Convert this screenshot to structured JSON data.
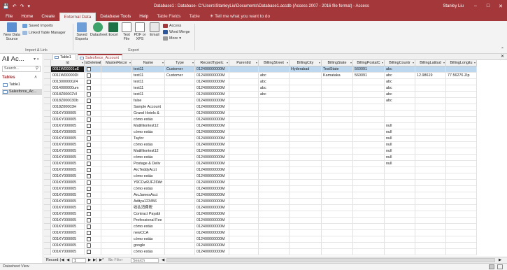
{
  "window": {
    "title": "Database1 : Database- C:\\Users\\StanleyLiu\\Documents\\Database1.accdb (Access 2007 - 2016 file format) - Access",
    "user": "Stanley Liu",
    "qat_icons": [
      "save-icon",
      "undo-icon",
      "redo-icon",
      "customize-icon"
    ]
  },
  "ribbon": {
    "tabs": [
      "File",
      "Home",
      "Create",
      "External Data",
      "Database Tools",
      "Help",
      "Table Fields",
      "Table"
    ],
    "active_tab": "External Data",
    "tell_me": "Tell me what you want to do",
    "import_group": {
      "label": "Import & Link",
      "new_data_source": "New Data Source",
      "saved_imports": "Saved Imports",
      "linked_table_manager": "Linked Table Manager"
    },
    "export_group": {
      "label": "Export",
      "saved_exports": "Saved Exports",
      "datasheet": "Datasheet",
      "excel": "Excel",
      "text_file": "Text File",
      "pdf_xps": "PDF or XPS",
      "email": "Email",
      "access": "Access",
      "word_merge": "Word Merge",
      "more": "More"
    }
  },
  "nav_pane": {
    "title": "All Ac...",
    "search_placeholder": "Search...",
    "section": "Tables",
    "items": [
      "Table1",
      "Salesforce_Ac..."
    ]
  },
  "doc_tabs": [
    "Table1",
    "Salesforce_Account"
  ],
  "grid": {
    "columns": [
      "Id",
      "IsDeleted",
      "MasterRecor",
      "Name",
      "Type",
      "RecordTypeIc",
      "ParentId",
      "BillingStreet",
      "BillingCity",
      "BillingState",
      "BillingPostalC",
      "BillingCountr",
      "BillingLatitud",
      "BillingLongitu"
    ],
    "rows": [
      [
        "0011W00001uE",
        "",
        "",
        "test11",
        "Customer",
        "012400000000M",
        "",
        "",
        "Hyderabad",
        "TestState",
        "560091",
        "abc",
        "",
        ""
      ],
      [
        "0011W00000Dl",
        "",
        "",
        "test11",
        "Customer",
        "012400000000M",
        "",
        "abc",
        "",
        "Karnataka",
        "560091",
        "abc",
        "12.98619",
        "77.56276 Zip"
      ],
      [
        "0013000000Z4",
        "",
        "",
        "test11",
        "",
        "012400000000M",
        "",
        "abc",
        "",
        "",
        "",
        "abc",
        "",
        ""
      ],
      [
        "0014000000um",
        "",
        "",
        "test11",
        "",
        "012400000000M",
        "",
        "abc",
        "",
        "",
        "",
        "abc",
        "",
        ""
      ],
      [
        "0018Z00002Vl",
        "",
        "",
        "test11",
        "",
        "012400000000M",
        "",
        "abc",
        "",
        "",
        "",
        "abc",
        "",
        ""
      ],
      [
        "0018Z00003Db",
        "",
        "",
        "false",
        "",
        "012400000000M",
        "",
        "",
        "",
        "",
        "",
        "abc",
        "",
        ""
      ],
      [
        "0018Z00003H",
        "",
        "",
        "Sample Account",
        "",
        "012400000000M",
        "",
        "",
        "",
        "",
        "",
        "",
        "",
        ""
      ],
      [
        "001KY000005",
        "",
        "",
        "Grand Hotels &",
        "",
        "012400000000M",
        "",
        "",
        "",
        "",
        "",
        "",
        "",
        ""
      ],
      [
        "001KY000005",
        "",
        "",
        "cómo estás",
        "",
        "012400000000M",
        "",
        "",
        "",
        "",
        "",
        "",
        "",
        ""
      ],
      [
        "001KY000005",
        "",
        "",
        "Matillliontest12",
        "",
        "012400000000M",
        "",
        "",
        "",
        "",
        "",
        "null",
        "",
        ""
      ],
      [
        "001KY000005",
        "",
        "",
        "cómo estás",
        "",
        "012400000000M",
        "",
        "",
        "",
        "",
        "",
        "null",
        "",
        ""
      ],
      [
        "001KY000005",
        "",
        "",
        "Taylor",
        "",
        "012400000000M",
        "",
        "",
        "",
        "",
        "",
        "null",
        "",
        ""
      ],
      [
        "001KY000005",
        "",
        "",
        "cómo estás",
        "",
        "012400000000M",
        "",
        "",
        "",
        "",
        "",
        "null",
        "",
        ""
      ],
      [
        "001KY000005",
        "",
        "",
        "Matillliontest12",
        "",
        "012400000000M",
        "",
        "",
        "",
        "",
        "",
        "null",
        "",
        ""
      ],
      [
        "001KY000005",
        "",
        "",
        "cómo estás",
        "",
        "012400000000M",
        "",
        "",
        "",
        "",
        "",
        "null",
        "",
        ""
      ],
      [
        "001KY000005",
        "",
        "",
        "Postage & Deliv",
        "",
        "012400000000M",
        "",
        "",
        "",
        "",
        "",
        "null",
        "",
        ""
      ],
      [
        "001KY000005",
        "",
        "",
        "ArcTeddyAcct",
        "",
        "012400000000M",
        "",
        "",
        "",
        "",
        "",
        "",
        "",
        ""
      ],
      [
        "001KY000005",
        "",
        "",
        "cómo estás",
        "",
        "012400000000M",
        "",
        "",
        "",
        "",
        "",
        "",
        "",
        ""
      ],
      [
        "001KY000005",
        "",
        "",
        "Y9CCwRJFZ6Wr",
        "",
        "012400000000M",
        "",
        "",
        "",
        "",
        "",
        "",
        "",
        ""
      ],
      [
        "001KY000005",
        "",
        "",
        "cómo estás",
        "",
        "012400000000M",
        "",
        "",
        "",
        "",
        "",
        "",
        "",
        ""
      ],
      [
        "001KY000005",
        "",
        "",
        "ArcJamesAcct",
        "",
        "012400000000M",
        "",
        "",
        "",
        "",
        "",
        "",
        "",
        ""
      ],
      [
        "001KY000005",
        "",
        "",
        "Aditya123456",
        "",
        "012400000000M",
        "",
        "",
        "",
        "",
        "",
        "",
        "",
        ""
      ],
      [
        "001KY000005",
        "",
        "",
        "收払消費税",
        "",
        "012400000000M",
        "",
        "",
        "",
        "",
        "",
        "",
        "",
        ""
      ],
      [
        "001KY000005",
        "",
        "",
        "Contract Payabl",
        "",
        "012400000000M",
        "",
        "",
        "",
        "",
        "",
        "",
        "",
        ""
      ],
      [
        "001KY000005",
        "",
        "",
        "Professional Fee",
        "",
        "012400000000M",
        "",
        "",
        "",
        "",
        "",
        "",
        "",
        ""
      ],
      [
        "001KY000005",
        "",
        "",
        "cómo estás",
        "",
        "012400000000M",
        "",
        "",
        "",
        "",
        "",
        "",
        "",
        ""
      ],
      [
        "001KY000005",
        "",
        "",
        "newCCA",
        "",
        "012400000000M",
        "",
        "",
        "",
        "",
        "",
        "",
        "",
        ""
      ],
      [
        "001KY000005",
        "",
        "",
        "cómo estás",
        "",
        "012400000000M",
        "",
        "",
        "",
        "",
        "",
        "",
        "",
        ""
      ],
      [
        "001KY000005",
        "",
        "",
        "google",
        "",
        "012400000000M",
        "",
        "",
        "",
        "",
        "",
        "",
        "",
        ""
      ],
      [
        "001KY000005",
        "",
        "",
        "cómo estás",
        "",
        "012400000000M",
        "",
        "",
        "",
        "",
        "",
        "",
        "",
        ""
      ]
    ]
  },
  "record_nav": {
    "label": "Record:",
    "position": "1",
    "filter": "No Filter",
    "search": "Search"
  },
  "status": {
    "view": "Datasheet View"
  }
}
